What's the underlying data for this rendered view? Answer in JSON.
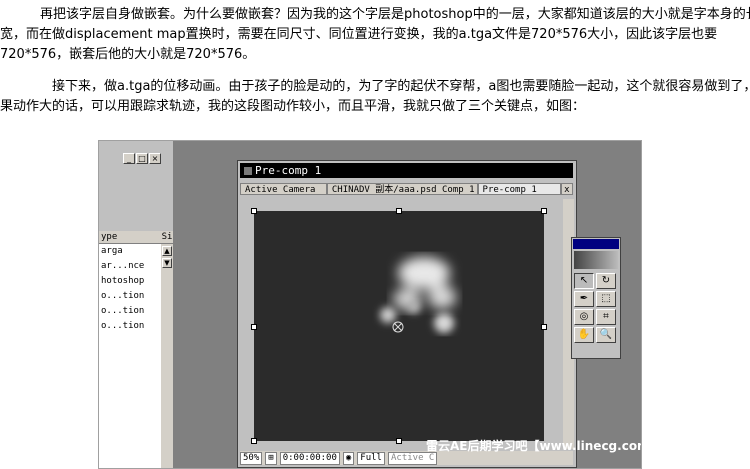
{
  "article": {
    "paragraph1": [
      "再把该字层自身做嵌套。为什么要做嵌套？因为我的这个字层是photoshop中的一层，大家都知道该层的大小就是字本身的长",
      "宽，而在做displacement map置换时，需要在同尺寸、同位置进行变换，我的a.tga文件是720*576大小，因此该字层也要",
      "720*576，嵌套后他的大小就是720*576。"
    ],
    "paragraph2": [
      "接下来，做a.tga的位移动画。由于孩子的脸是动的，为了字的起伏不穿帮，a图也需要随脸一起动，这个就很容易做到了，如",
      "果动作大的话，可以用跟踪求轨迹，我的这段图动作较小，而且平滑，我就只做了三个关键点，如图："
    ]
  },
  "screenshot": {
    "left_panel": {
      "list_header": "ype",
      "scroll_header": "Si",
      "rows": [
        "arga",
        "ar...nce",
        "hotoshop",
        "o...tion",
        "o...tion",
        "o...tion"
      ]
    },
    "precomp_window": {
      "title": "Pre-comp 1",
      "tabs": [
        "Active Camera",
        "CHINADV 副本/aaa.psd Comp 1",
        "Pre-comp 1"
      ],
      "tab_close": "x",
      "bottom": {
        "zoom": "50%",
        "timecode": "0:00:00:00",
        "resolution": "Full",
        "view": "Active C"
      }
    },
    "tools": {
      "buttons": [
        "arrow",
        "rotate",
        "pen",
        "mask",
        "pan-behind",
        "crop",
        "hand",
        "zoom"
      ]
    },
    "watermark": "雷云AE后期学习吧【www.linecg.com/tieba/1775】"
  }
}
